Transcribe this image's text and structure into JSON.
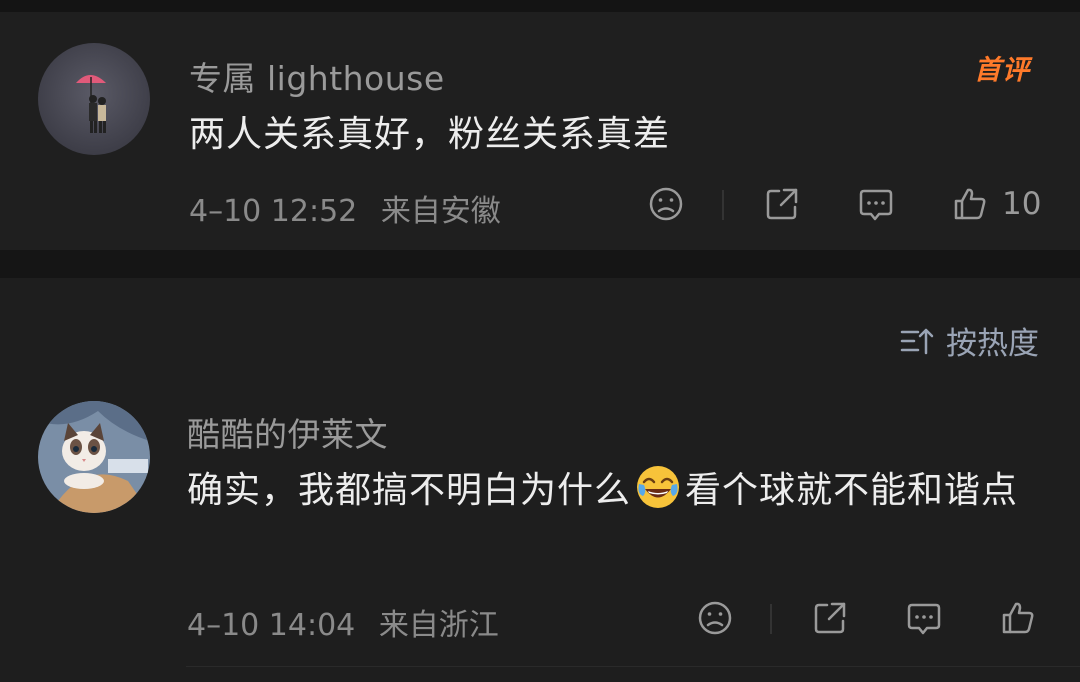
{
  "comments": [
    {
      "username": "专属 lighthouse",
      "text": "两人关系真好，粉丝关系真差",
      "date": "4–10 12:52",
      "location": "来自安徽",
      "badge": "首评",
      "likes": "10"
    },
    {
      "username": "酷酷的伊莱文",
      "text_before": "确实，我都搞不明白为什么",
      "emoji": "laughing-crying-emoji",
      "text_after": "看个球就不能和谐点",
      "date": "4–10 14:04",
      "location": "来自浙江",
      "likes": ""
    }
  ],
  "sort": {
    "label": "按热度"
  },
  "colors": {
    "background": "#1f1f1f",
    "badge": "#ff7a2a",
    "sort": "#9aa4b5"
  }
}
